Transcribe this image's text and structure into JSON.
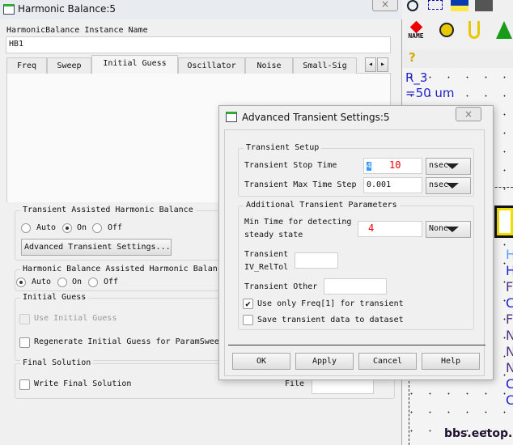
{
  "main_window": {
    "title": "Harmonic Balance:5",
    "instance_label": "HarmonicBalance Instance Name",
    "instance_value": "HB1",
    "tabs": [
      "Freq",
      "Sweep",
      "Initial Guess",
      "Oscillator",
      "Noise",
      "Small-Sig"
    ],
    "active_tab": "Initial Guess",
    "tah": {
      "legend": "Transient Assisted Harmonic Balance",
      "options": [
        "Auto",
        "On",
        "Off"
      ],
      "selected": "On",
      "advanced_button": "Advanced Transient Settings..."
    },
    "hbah": {
      "legend": "Harmonic Balance Assisted Harmonic Balance",
      "options": [
        "Auto",
        "On",
        "Off"
      ],
      "selected": "Auto"
    },
    "initial_guess": {
      "legend": "Initial Guess",
      "use_initial_guess": "Use Initial Guess",
      "regenerate": "Regenerate Initial Guess for ParamSweep"
    },
    "final_solution": {
      "legend": "Final Solution",
      "write": "Write Final Solution",
      "file_label": "File"
    }
  },
  "dialog": {
    "title": "Advanced Transient Settings:5",
    "setup_legend": "Transient Setup",
    "stop_time_label": "Transient Stop Time",
    "stop_time_sel": "4",
    "stop_time_rest": "10",
    "stop_time_unit": "nsec",
    "max_step_label": "Transient Max Time Step",
    "max_step_value": "0.001",
    "max_step_unit": "nsec",
    "additional_legend": "Additional Transient Parameters",
    "min_time_label1": "Min Time for detecting",
    "min_time_label2": "steady state",
    "min_time_value": "4",
    "min_time_unit": "None",
    "reltol_label1": "Transient",
    "reltol_label2": "IV_RelTol",
    "other_label": "Transient Other",
    "use_freq1": {
      "label": "Use only Freq[1] for transient",
      "checked": true
    },
    "save_data": {
      "label": "Save transient data to dataset",
      "checked": false
    },
    "buttons": {
      "ok": "OK",
      "apply": "Apply",
      "cancel": "Cancel",
      "help": "Help"
    },
    "close": "×"
  },
  "schematic": {
    "toolbar_name_label": "NAME",
    "texts": [
      "R_3",
      "=50 um"
    ],
    "letters": [
      "H",
      "H",
      "F",
      "C",
      "F",
      "N",
      "N",
      "N",
      "C",
      "C"
    ],
    "watermark": "bbs.eetop.cn"
  }
}
